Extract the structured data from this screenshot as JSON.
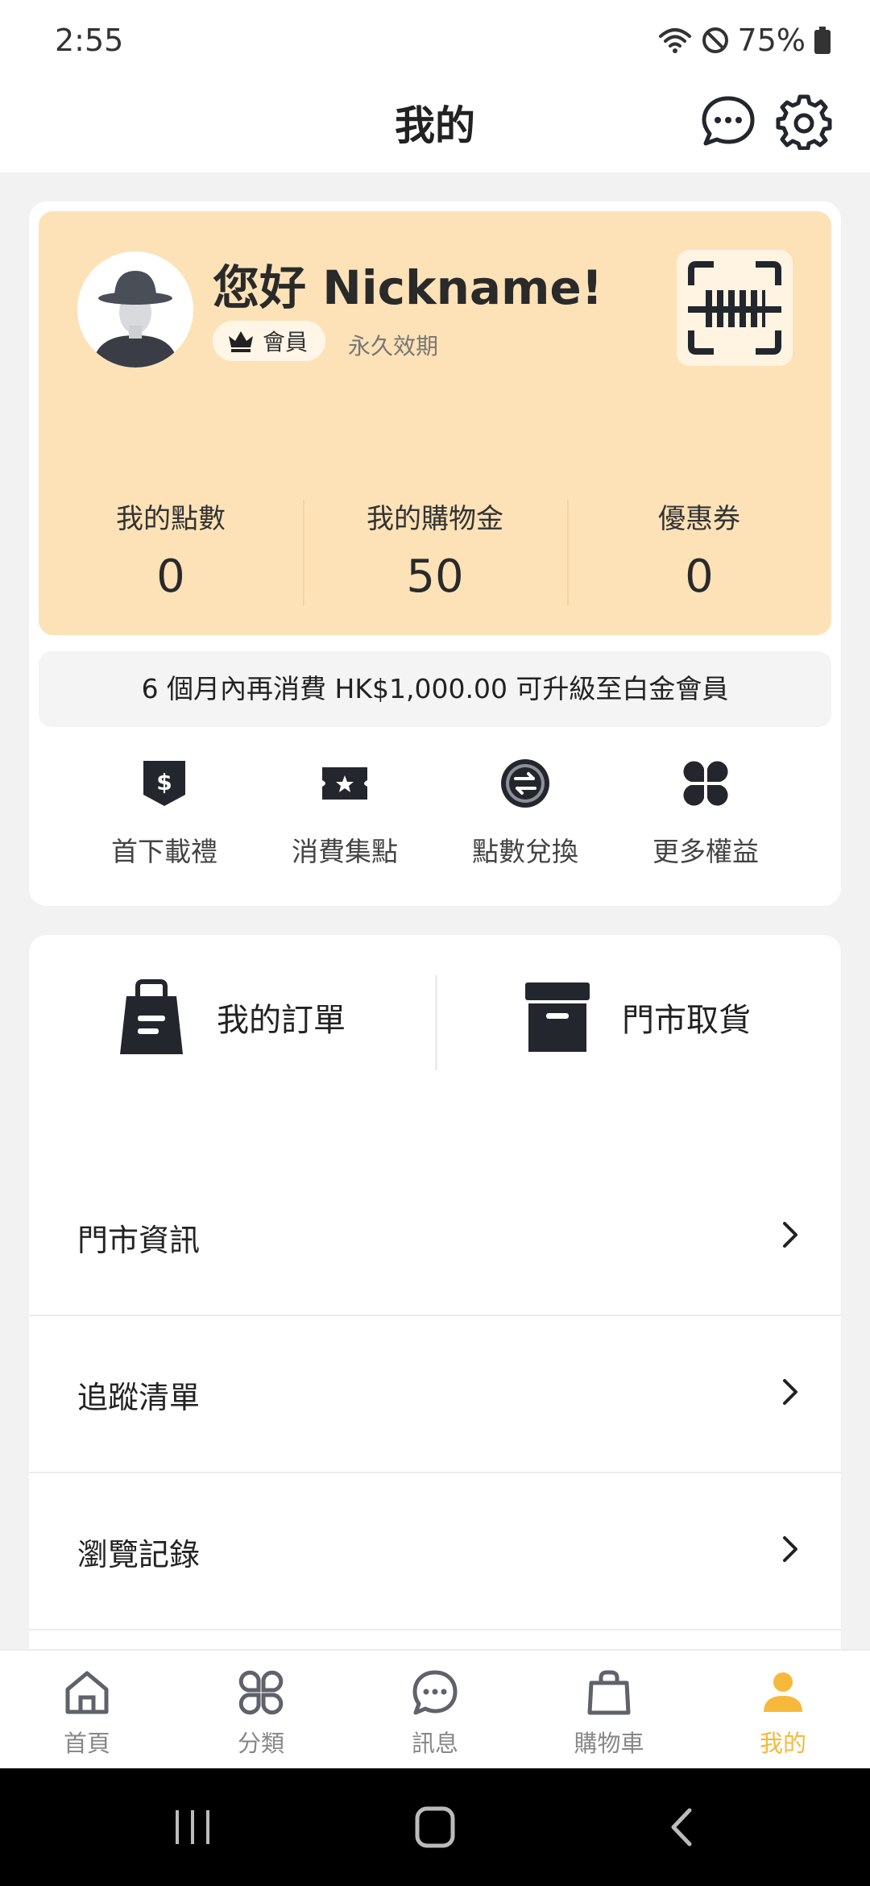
{
  "status_bar": {
    "time": "2:55",
    "battery": "75%"
  },
  "header": {
    "title": "我的"
  },
  "profile": {
    "greeting": "您好 Nickname!",
    "tier_badge": "會員",
    "validity": "永久效期"
  },
  "stats": [
    {
      "label": "我的點數",
      "value": "0"
    },
    {
      "label": "我的購物金",
      "value": "50"
    },
    {
      "label": "優惠券",
      "value": "0"
    }
  ],
  "upgrade_notice": "6 個月內再消費 HK$1,000.00 可升級至白金會員",
  "benefits": [
    {
      "label": "首下載禮",
      "icon": "dollar-shield-icon"
    },
    {
      "label": "消費集點",
      "icon": "star-ticket-icon"
    },
    {
      "label": "點數兌換",
      "icon": "exchange-icon"
    },
    {
      "label": "更多權益",
      "icon": "more-grid-icon"
    }
  ],
  "orders": [
    {
      "label": "我的訂單",
      "icon": "shopping-bag-icon"
    },
    {
      "label": "門市取貨",
      "icon": "archive-box-icon"
    }
  ],
  "menu": [
    {
      "label": "門市資訊"
    },
    {
      "label": "追蹤清單"
    },
    {
      "label": "瀏覽記錄"
    }
  ],
  "tabs": [
    {
      "label": "首頁",
      "icon": "home-icon"
    },
    {
      "label": "分類",
      "icon": "category-icon"
    },
    {
      "label": "訊息",
      "icon": "message-icon"
    },
    {
      "label": "購物車",
      "icon": "cart-icon"
    },
    {
      "label": "我的",
      "icon": "profile-icon",
      "active": true
    }
  ],
  "colors": {
    "accent": "#f6b93b",
    "card_bg": "#fde2b8",
    "icon_dark": "#23262d"
  }
}
